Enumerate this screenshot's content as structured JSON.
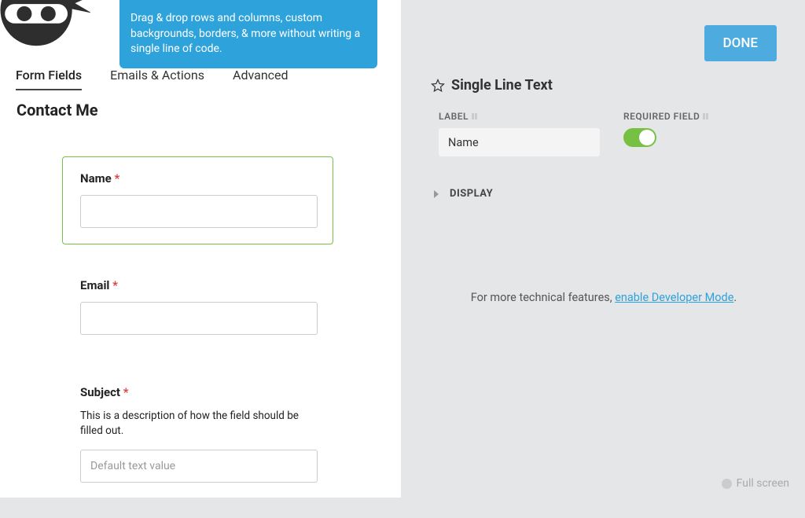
{
  "tooltip": "Drag & drop rows and columns, custom backgrounds, borders, & more without writing a single line of code.",
  "tabs": {
    "formFields": "Form Fields",
    "emailsActions": "Emails & Actions",
    "advanced": "Advanced"
  },
  "formTitle": "Contact Me",
  "fields": {
    "name": {
      "label": "Name",
      "required": "*"
    },
    "email": {
      "label": "Email",
      "required": "*"
    },
    "subject": {
      "label": "Subject",
      "required": "*",
      "description": "This is a description of how the field should be filled out.",
      "placeholder": "Default text value"
    }
  },
  "doneButton": "DONE",
  "settings": {
    "title": "Single Line Text",
    "labelLabel": "LABEL",
    "labelValue": "Name",
    "requiredLabel": "REQUIRED FIELD",
    "requiredOn": true,
    "displaySection": "DISPLAY"
  },
  "devMode": {
    "prefix": "For more technical features, ",
    "link": "enable Developer Mode",
    "suffix": "."
  },
  "fullscreen": "Full screen"
}
